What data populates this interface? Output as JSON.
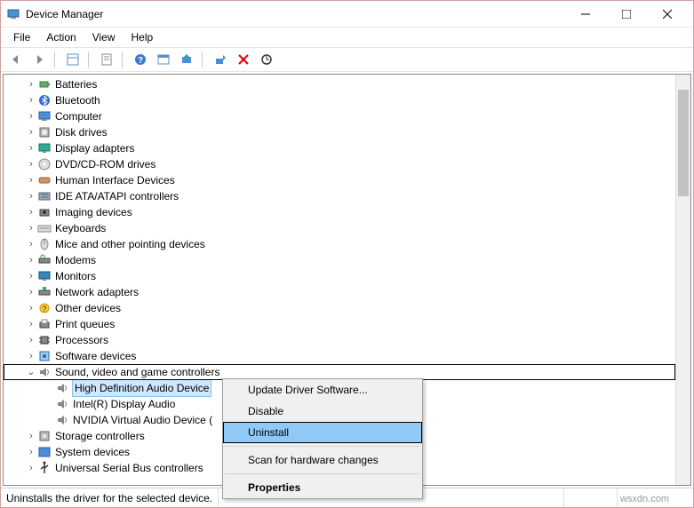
{
  "window": {
    "title": "Device Manager"
  },
  "menubar": [
    "File",
    "Action",
    "View",
    "Help"
  ],
  "tree": {
    "nodes": [
      {
        "label": "Batteries",
        "icon": "battery"
      },
      {
        "label": "Bluetooth",
        "icon": "bluetooth"
      },
      {
        "label": "Computer",
        "icon": "computer"
      },
      {
        "label": "Disk drives",
        "icon": "disk"
      },
      {
        "label": "Display adapters",
        "icon": "display"
      },
      {
        "label": "DVD/CD-ROM drives",
        "icon": "dvd"
      },
      {
        "label": "Human Interface Devices",
        "icon": "hid"
      },
      {
        "label": "IDE ATA/ATAPI controllers",
        "icon": "ide"
      },
      {
        "label": "Imaging devices",
        "icon": "camera"
      },
      {
        "label": "Keyboards",
        "icon": "keyboard"
      },
      {
        "label": "Mice and other pointing devices",
        "icon": "mouse"
      },
      {
        "label": "Modems",
        "icon": "modem"
      },
      {
        "label": "Monitors",
        "icon": "monitor"
      },
      {
        "label": "Network adapters",
        "icon": "network"
      },
      {
        "label": "Other devices",
        "icon": "other"
      },
      {
        "label": "Print queues",
        "icon": "printer"
      },
      {
        "label": "Processors",
        "icon": "cpu"
      },
      {
        "label": "Software devices",
        "icon": "software"
      }
    ],
    "expanded": {
      "label": "Sound, video and game controllers",
      "icon": "sound",
      "children": [
        {
          "label": "High Definition Audio Device",
          "selected": true
        },
        {
          "label": "Intel(R) Display Audio"
        },
        {
          "label": "NVIDIA Virtual Audio Device ("
        }
      ]
    },
    "tail": [
      {
        "label": "Storage controllers",
        "icon": "storage"
      },
      {
        "label": "System devices",
        "icon": "system"
      },
      {
        "label": "Universal Serial Bus controllers",
        "icon": "usb"
      }
    ]
  },
  "context_menu": {
    "items": [
      {
        "label": "Update Driver Software..."
      },
      {
        "label": "Disable"
      },
      {
        "label": "Uninstall",
        "highlighted": true
      },
      {
        "sep": true
      },
      {
        "label": "Scan for hardware changes"
      },
      {
        "sep": true
      },
      {
        "label": "Properties",
        "bold": true
      }
    ]
  },
  "status": {
    "text": "Uninstalls the driver for the selected device."
  },
  "watermark": "wsxdn.com"
}
